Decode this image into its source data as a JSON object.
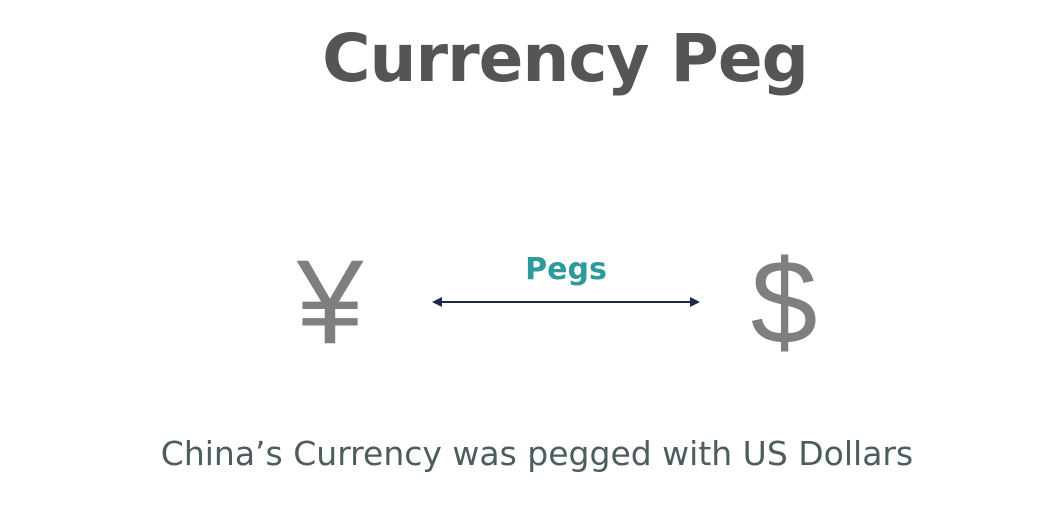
{
  "title": "Currency Peg",
  "left_symbol": "¥",
  "left_symbol_icon": "yen-icon",
  "right_symbol": "$",
  "right_symbol_icon": "dollar-icon",
  "relation_label": "Pegs",
  "caption": "China’s Currency was pegged with US Dollars",
  "colors": {
    "title": "#555555",
    "symbols": "#7f7f7f",
    "relation_label": "#2e9a9c",
    "arrow": "#1f2a4a",
    "caption": "#4d5d5d"
  }
}
